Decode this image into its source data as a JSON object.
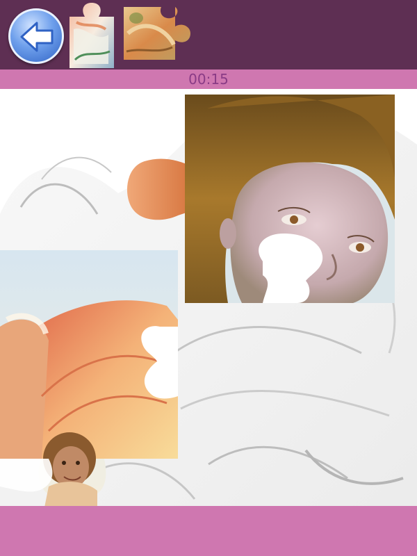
{
  "header": {
    "back_button_icon": "back-arrow-icon"
  },
  "tray": {
    "pieces": [
      {
        "name": "tray-piece-1"
      },
      {
        "name": "tray-piece-2"
      }
    ]
  },
  "timer": {
    "value": "00:15"
  },
  "board": {
    "placed_pieces": 2
  },
  "colors": {
    "header_bg": "#5e2f53",
    "bar_pink": "#cf77b0",
    "timer_text": "#8a3b86",
    "button_blue": "#2f62c4"
  }
}
